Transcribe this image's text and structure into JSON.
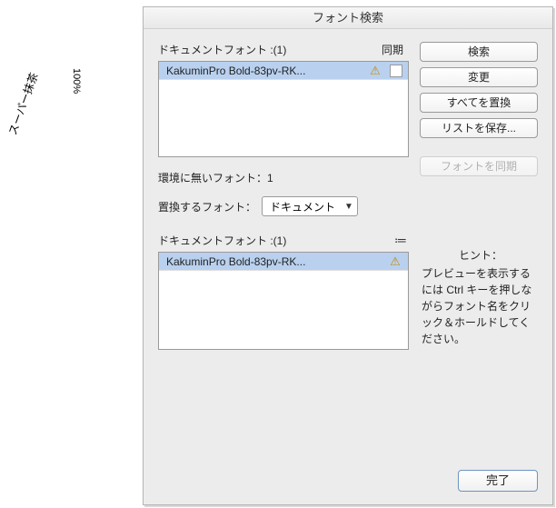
{
  "background": {
    "zoom_label": "100%",
    "doc_title": "スーパー抹茶"
  },
  "dialog": {
    "title": "フォント検索",
    "list_header": "ドキュメントフォント :(1)",
    "sync_header": "同期",
    "fonts": [
      {
        "name": "KakuminPro Bold-83pv-RK...",
        "warning": true,
        "sync": false
      }
    ],
    "missing_label": "環境に無いフォント：1",
    "replace_label": "置換するフォント：",
    "replace_scope_options": [
      "ドキュメント"
    ],
    "replace_scope_selected": "ドキュメント",
    "list2_header": "ドキュメントフォント :(1)",
    "fonts2": [
      {
        "name": "KakuminPro Bold-83pv-RK...",
        "warning": true
      }
    ],
    "buttons": {
      "search": "検索",
      "change": "変更",
      "change_all": "すべてを置換",
      "save_list": "リストを保存...",
      "sync_fonts": "フォントを同期",
      "done": "完了"
    },
    "hint": {
      "title": "ヒント：",
      "body": "プレビューを表示するには Ctrl キーを押しながらフォント名をクリック＆ホールドしてください。"
    },
    "icons": {
      "warning": "⚠",
      "list_menu": "≔",
      "dropdown_arrow": "▼"
    }
  }
}
